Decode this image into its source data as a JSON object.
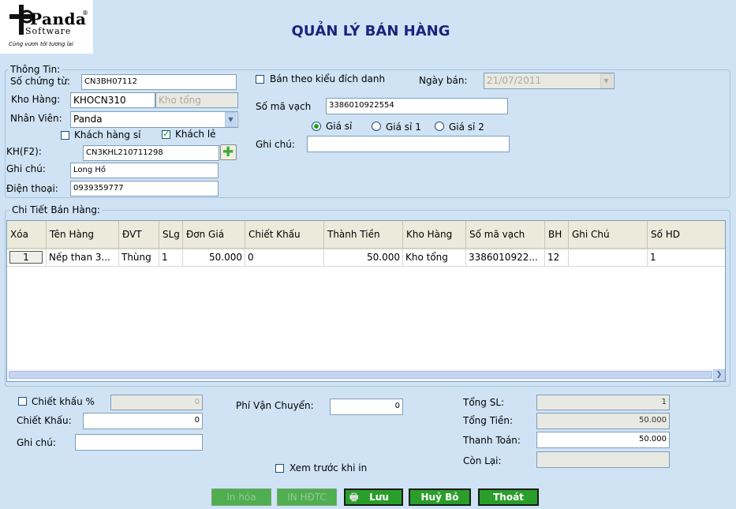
{
  "header": {
    "logo_brand": "Panda",
    "logo_sub": "Software",
    "logo_tagline": "Cùng vươn tới tương lai",
    "title": "QUẢN LÝ BÁN HÀNG"
  },
  "info": {
    "legend": "Thông Tin:",
    "so_chung_tu_label": "Số chứng từ:",
    "so_chung_tu_value": "CN3BH07112",
    "kho_hang_label": "Kho Hàng:",
    "kho_hang_code": "KHOCN310",
    "kho_hang_name": "Kho tổng",
    "nhan_vien_label": "Nhân Viên:",
    "nhan_vien_value": "Panda",
    "khach_hang_si_label": "Khách hàng sỉ",
    "khach_hang_si_checked": false,
    "khach_le_label": "Khách lẻ",
    "khach_le_checked": true,
    "kh_label": "KH(F2):",
    "kh_value": "CN3KHL210711298",
    "ghi_chu_label": "Ghi chú:",
    "ghi_chu_value": "Long Hồ",
    "dien_thoai_label": "Điện thoại:",
    "dien_thoai_value": "0939359777",
    "ban_theo_label": "Bán theo kiểu đích danh",
    "ban_theo_checked": false,
    "ngay_ban_label": "Ngày bán:",
    "ngay_ban_value": "21/07/2011",
    "so_ma_vach_label": "Số mã vạch",
    "so_ma_vach_value": "3386010922554",
    "gia_options": [
      "Giá sỉ",
      "Giá sỉ 1",
      "Giá sỉ 2"
    ],
    "gia_selected": "Giá sỉ",
    "ghi_chu2_label": "Ghi chú:",
    "ghi_chu2_value": ""
  },
  "detail": {
    "legend": "Chi Tiết Bán Hàng:",
    "columns": [
      "Xóa",
      "Tên Hàng",
      "ĐVT",
      "SLg",
      "Đơn Giá",
      "Chiết Khấu",
      "Thành Tiền",
      "Kho Hàng",
      "Số mã vạch",
      "BH",
      "Ghi Chú",
      "Số HD"
    ],
    "rows": [
      [
        "1",
        "Nếp than 3...",
        "Thùng",
        "1",
        "50.000",
        "0",
        "50.000",
        "Kho tổng",
        "3386010922...",
        "12",
        "",
        "1"
      ]
    ]
  },
  "footer": {
    "chiet_khau_pct_label": "Chiết khấu %",
    "chiet_khau_pct_checked": false,
    "chiet_khau_pct_value": "0",
    "chiet_khau_label": "Chiết Khấu:",
    "chiet_khau_value": "0",
    "ghi_chu_label": "Ghi chú:",
    "ghi_chu_value": "",
    "phi_van_chuyen_label": "Phí Vận Chuyển:",
    "phi_van_chuyen_value": "0",
    "xem_truoc_label": "Xem trước khi in",
    "xem_truoc_checked": false,
    "tong_sl_label": "Tổng SL:",
    "tong_sl_value": "1",
    "tong_tien_label": "Tổng Tiền:",
    "tong_tien_value": "50.000",
    "thanh_toan_label": "Thanh Toán:",
    "thanh_toan_value": "50.000",
    "con_lai_label": "Còn Lại:",
    "con_lai_value": ""
  },
  "buttons": {
    "in_hoa_don": "In hóa",
    "in_hdtc": "IN HĐTC",
    "luu": "Lưu",
    "huy_bo": "Huỷ Bỏ",
    "thoat": "Thoát"
  },
  "colors": {
    "background": "#cfe3f5",
    "title": "#1a237e",
    "button_green": "#2a9e2a",
    "check_green": "#21a121"
  }
}
